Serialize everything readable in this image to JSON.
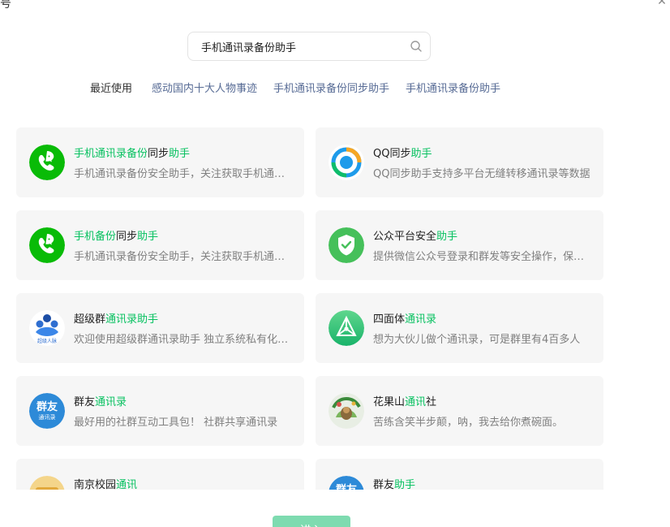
{
  "window": {
    "title": "号",
    "close_glyph": "✕"
  },
  "search": {
    "value": "手机通讯录备份助手",
    "icon": "search-icon"
  },
  "recent": {
    "label": "最近使用",
    "items": [
      "感动国内十大人物事迹",
      "手机通讯录备份同步助手",
      "手机通讯录备份助手"
    ]
  },
  "colors": {
    "highlight": "#07c160",
    "link": "#576b95",
    "card_bg": "#f6f6f6",
    "button": "#7edbb0"
  },
  "results": [
    {
      "name_parts": [
        {
          "t": "手机通讯录备份",
          "h": true
        },
        {
          "t": "同步",
          "h": false
        },
        {
          "t": "助手",
          "h": true
        }
      ],
      "desc": "手机通讯录备份安全助手，关注获取手机通讯录备份服务",
      "icon": "phone-chat-green-icon"
    },
    {
      "name_parts": [
        {
          "t": "QQ同步",
          "h": false
        },
        {
          "t": "助手",
          "h": true
        }
      ],
      "desc": "QQ同步助手支持多平台无缝转移通讯录等数据",
      "icon": "qq-sync-icon"
    },
    {
      "name_parts": [
        {
          "t": "手机备份",
          "h": true
        },
        {
          "t": "同步",
          "h": false
        },
        {
          "t": "助手",
          "h": true
        }
      ],
      "desc": "手机通讯录备份安全助手，关注获取手机通讯录备份服务",
      "icon": "phone-chat-green-icon"
    },
    {
      "name_parts": [
        {
          "t": "公众平台安全",
          "h": false
        },
        {
          "t": "助手",
          "h": true
        }
      ],
      "desc": "提供微信公众号登录和群发等安全操作，保障帐号安全",
      "icon": "shield-check-icon"
    },
    {
      "name_parts": [
        {
          "t": "超级群",
          "h": false
        },
        {
          "t": "通讯录助手",
          "h": true
        }
      ],
      "desc": "欢迎使用超级群通讯录助手 独立系统私有化部署",
      "icon": "super-group-icon"
    },
    {
      "name_parts": [
        {
          "t": "四面体",
          "h": false
        },
        {
          "t": "通讯录",
          "h": true
        }
      ],
      "desc": "想为大伙儿做个通讯录，可是群里有4百多人",
      "icon": "tetrahedron-icon"
    },
    {
      "name_parts": [
        {
          "t": "群友",
          "h": false
        },
        {
          "t": "通讯录",
          "h": true
        }
      ],
      "desc": "最好用的社群互动工具包！ 社群共享通讯录",
      "icon": "qunyou-icon"
    },
    {
      "name_parts": [
        {
          "t": "花果山",
          "h": false
        },
        {
          "t": "通讯",
          "h": true
        },
        {
          "t": "社",
          "h": false
        }
      ],
      "desc": "苦练含笑半步颠，呐，我去给你煮碗面。",
      "icon": "monkey-avatar-icon"
    },
    {
      "name_parts": [
        {
          "t": "南京校园",
          "h": false
        },
        {
          "t": "通讯",
          "h": true
        }
      ],
      "desc": "",
      "icon": "campus-icon"
    },
    {
      "name_parts": [
        {
          "t": "群友",
          "h": false
        },
        {
          "t": "助手",
          "h": true
        }
      ],
      "desc": "",
      "icon": "qunyou-icon"
    }
  ],
  "bottom_button": {
    "label": "进入"
  }
}
